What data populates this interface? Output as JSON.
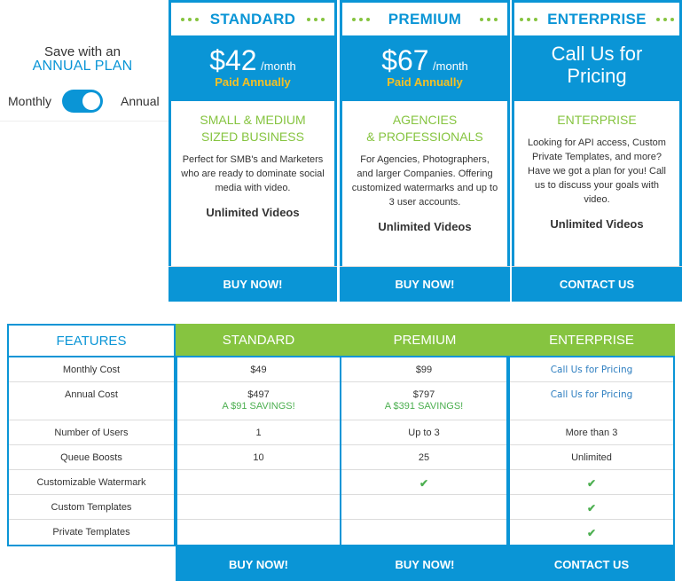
{
  "colors": {
    "brand_blue": "#0a95d6",
    "accent_green": "#86c440",
    "paid_yellow": "#f4c024",
    "savings_green": "#4caf50",
    "link_blue": "#2d7ec0"
  },
  "billing_toggle": {
    "headline": "Save with an",
    "highlight": "ANNUAL PLAN",
    "left_label": "Monthly",
    "right_label": "Annual",
    "state": "Annual"
  },
  "plans": [
    {
      "name": "STANDARD",
      "price": "$42",
      "per": "/month",
      "billing_note": "Paid Annually",
      "segment_line1": "SMALL & MEDIUM",
      "segment_line2": "SIZED BUSINESS",
      "description": "Perfect for SMB's and Marketers who are ready to dominate social media with video.",
      "feature": "Unlimited Videos",
      "button": "BUY NOW!"
    },
    {
      "name": "PREMIUM",
      "price": "$67",
      "per": "/month",
      "billing_note": "Paid Annually",
      "segment_line1": "AGENCIES",
      "segment_line2": "& PROFESSIONALS",
      "description": "For Agencies, Photographers, and larger Companies. Offering customized watermarks and up to 3 user accounts.",
      "feature": "Unlimited Videos",
      "button": "BUY NOW!"
    },
    {
      "name": "ENTERPRISE",
      "price_line1": "Call Us for",
      "price_line2": "Pricing",
      "segment_line1": "ENTERPRISE",
      "description": "Looking for API access, Custom Private Templates, and more? Have we got a plan for you! Call us to discuss your goals with video.",
      "feature": "Unlimited Videos",
      "button": "CONTACT US"
    }
  ],
  "features_table": {
    "header": [
      "FEATURES",
      "STANDARD",
      "PREMIUM",
      "ENTERPRISE"
    ],
    "rows": [
      {
        "label": "Monthly Cost",
        "standard": "$49",
        "premium": "$99",
        "enterprise": "Call Us for Pricing"
      },
      {
        "label": "Annual Cost",
        "standard": "$497",
        "standard_savings": "A $91 SAVINGS!",
        "premium": "$797",
        "premium_savings": "A $391 SAVINGS!",
        "enterprise": "Call Us for Pricing"
      },
      {
        "label": "Number of Users",
        "standard": "1",
        "premium": "Up to 3",
        "enterprise": "More than 3"
      },
      {
        "label": "Queue Boosts",
        "standard": "10",
        "premium": "25",
        "enterprise": "Unlimited"
      },
      {
        "label": "Customizable Watermark",
        "standard": "",
        "premium": "✔",
        "enterprise": "✔"
      },
      {
        "label": "Custom Templates",
        "standard": "",
        "premium": "",
        "enterprise": "✔"
      },
      {
        "label": "Private Templates",
        "standard": "",
        "premium": "",
        "enterprise": "✔"
      }
    ],
    "buttons": [
      "BUY NOW!",
      "BUY NOW!",
      "CONTACT US"
    ]
  }
}
